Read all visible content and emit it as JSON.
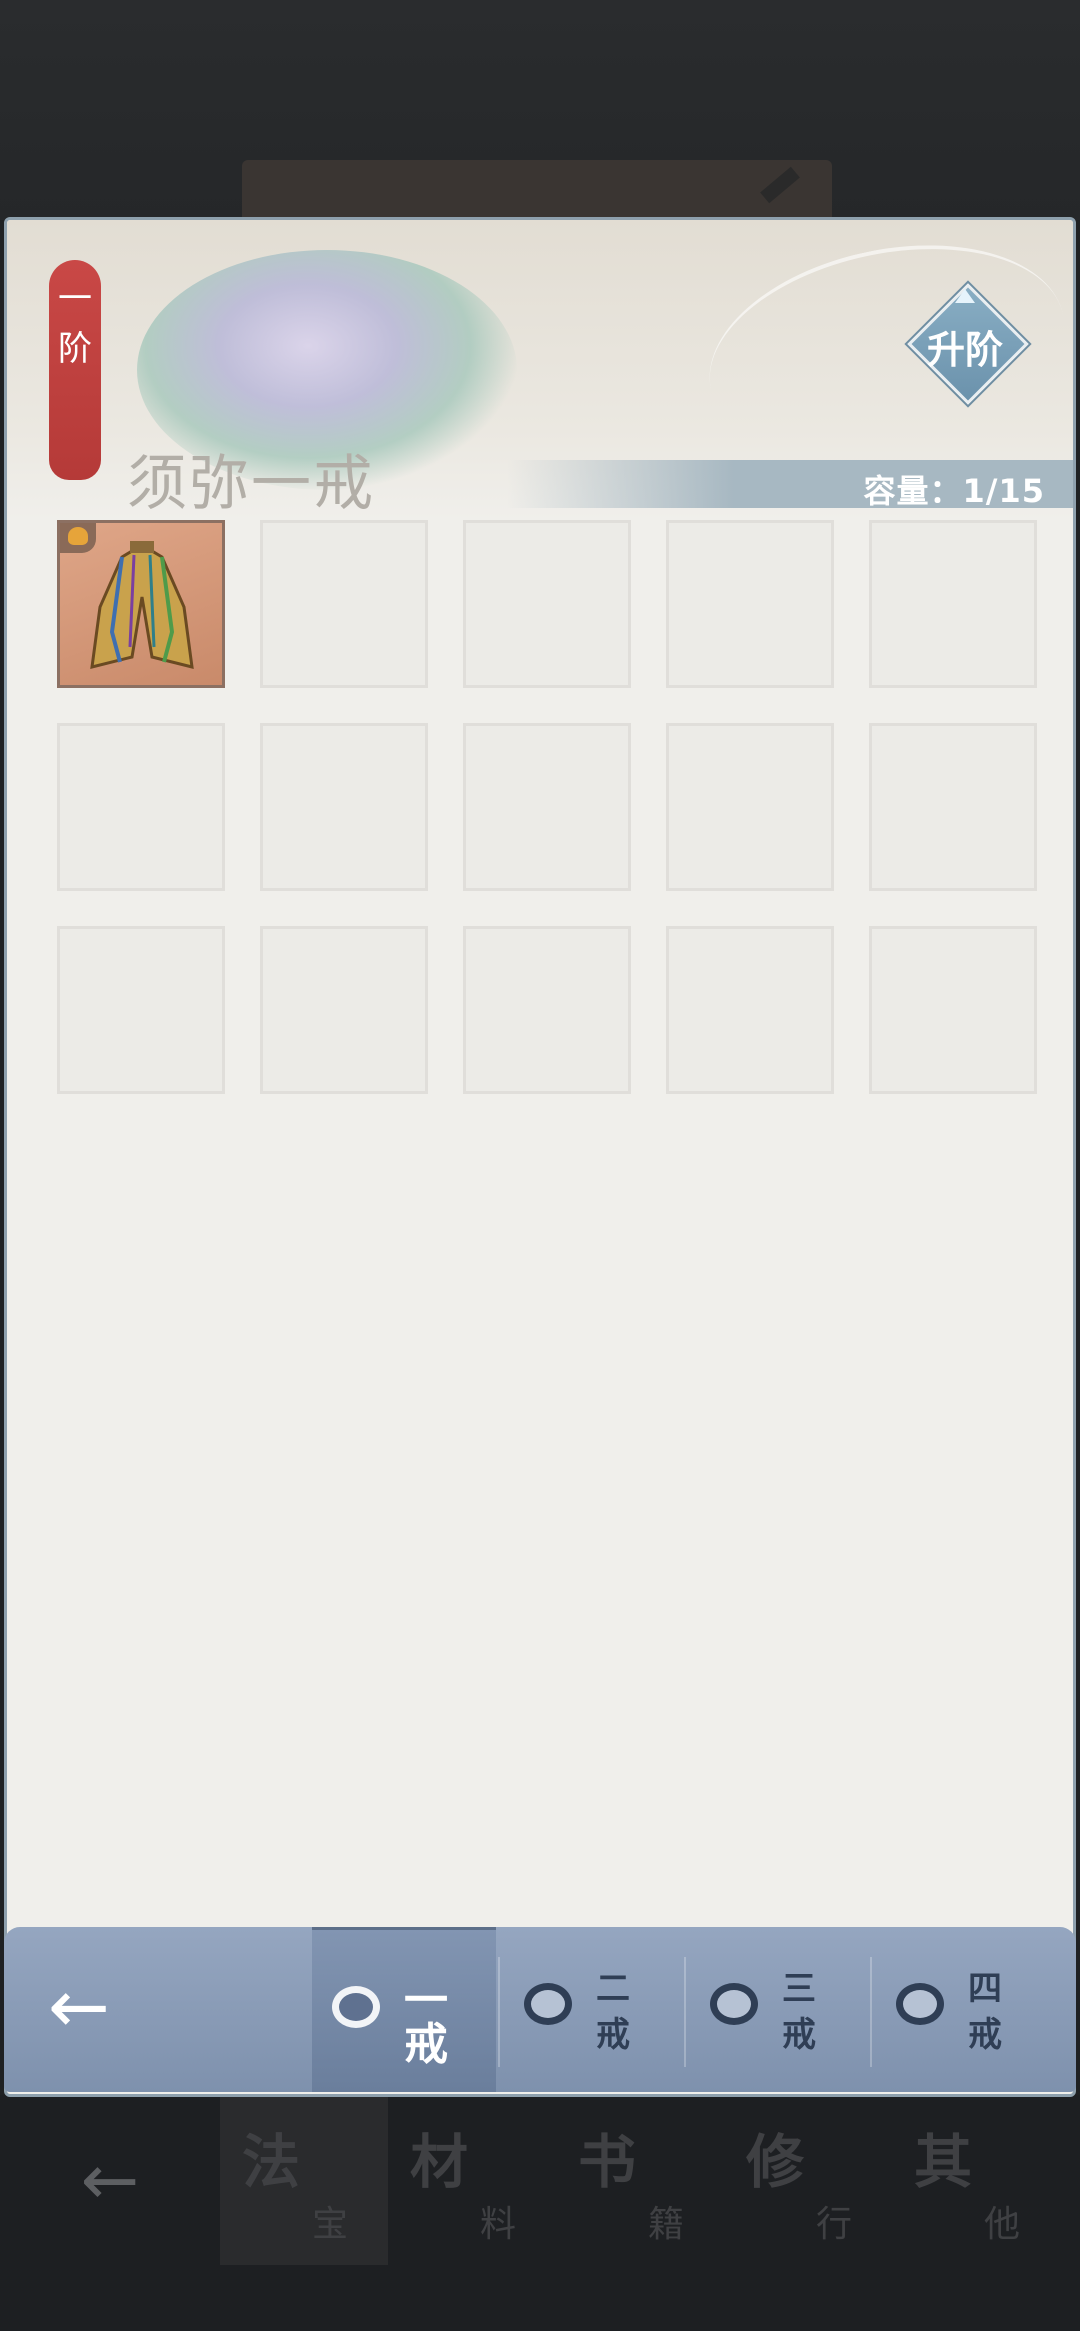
{
  "background_nav": {
    "back_icon": "arrow-left-icon",
    "tabs": [
      {
        "big": "法",
        "small": "宝"
      },
      {
        "big": "材",
        "small": "料"
      },
      {
        "big": "书",
        "small": "籍"
      },
      {
        "big": "修",
        "small": "行"
      },
      {
        "big": "其",
        "small": "他"
      }
    ]
  },
  "modal": {
    "tier_badge": {
      "line1": "一",
      "line2": "阶"
    },
    "title": "须弥一戒",
    "capacity": "容量：1/15",
    "upgrade_button": "升阶"
  },
  "tabbar": {
    "back_icon": "arrow-left-icon",
    "tabs": [
      {
        "line1": "一",
        "line2": "戒",
        "icon": "ring-icon"
      },
      {
        "line1": "二",
        "line2": "戒",
        "icon": "ring-icon"
      },
      {
        "line1": "三",
        "line2": "戒",
        "icon": "ring-icon"
      },
      {
        "line1": "四",
        "line2": "戒",
        "icon": "ring-icon"
      }
    ],
    "active_index": 0
  },
  "grid": {
    "item_art": "robe-item-icon",
    "item_badge": "quality-badge-icon"
  },
  "colors": {
    "tier_red": "#c94846",
    "tabbar_blue": "#8a9cb8",
    "upgrade_blue": "#7aa0b8"
  }
}
